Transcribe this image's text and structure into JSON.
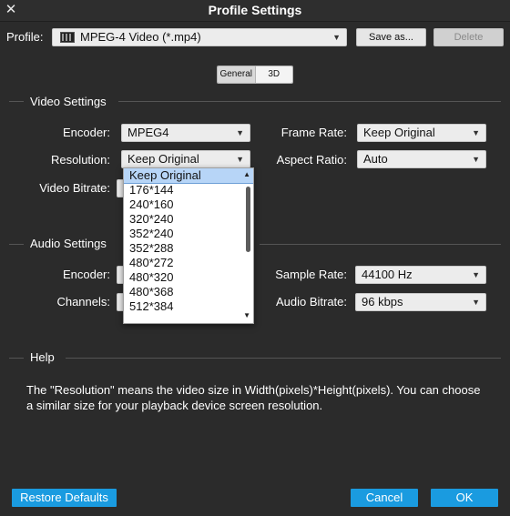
{
  "window": {
    "title": "Profile Settings",
    "close_glyph": "✕"
  },
  "profile": {
    "label": "Profile:",
    "value": "MPEG-4 Video (*.mp4)",
    "icon": "mp4-file-icon",
    "save_as": "Save as...",
    "delete": "Delete"
  },
  "tabs": [
    {
      "label": "General",
      "active": true
    },
    {
      "label": "3D",
      "active": false
    }
  ],
  "video": {
    "section": "Video Settings",
    "encoder_label": "Encoder:",
    "encoder_value": "MPEG4",
    "frame_rate_label": "Frame Rate:",
    "frame_rate_value": "Keep Original",
    "resolution_label": "Resolution:",
    "resolution_value": "Keep Original",
    "aspect_label": "Aspect Ratio:",
    "aspect_value": "Auto",
    "bitrate_label": "Video Bitrate:"
  },
  "audio": {
    "section": "Audio Settings",
    "encoder_label": "Encoder:",
    "sample_rate_label": "Sample Rate:",
    "sample_rate_value": "44100 Hz",
    "channels_label": "Channels:",
    "bitrate_label": "Audio Bitrate:",
    "bitrate_value": "96 kbps"
  },
  "resolution_dropdown": {
    "options": [
      "Keep Original",
      "176*144",
      "240*160",
      "320*240",
      "352*240",
      "352*288",
      "480*272",
      "480*320",
      "480*368",
      "512*384"
    ],
    "selected": "Keep Original"
  },
  "help": {
    "section": "Help",
    "text": "The \"Resolution\" means the video size in Width(pixels)*Height(pixels).  You can choose a similar size for your playback device screen resolution."
  },
  "footer": {
    "restore": "Restore Defaults",
    "cancel": "Cancel",
    "ok": "OK"
  },
  "colors": {
    "background": "#2b2b2b",
    "accent_button": "#1a9be0",
    "selection": "#b7d5f7"
  }
}
